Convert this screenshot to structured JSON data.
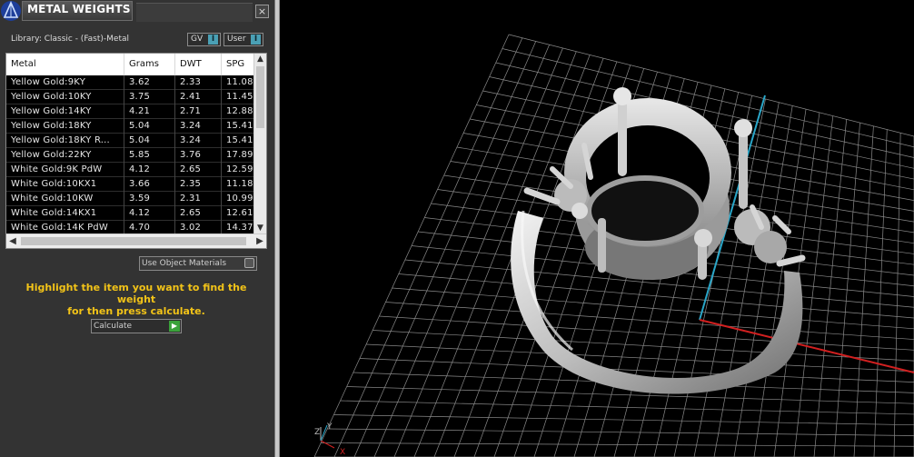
{
  "panel": {
    "title": "METAL WEIGHTS",
    "close_glyph": "×",
    "library_label": "Library: Classic - (Fast)-Metal",
    "toggle_gv": "GV",
    "toggle_user": "User",
    "toggle_glyph": "I",
    "table": {
      "columns": [
        "Metal",
        "Grams",
        "DWT",
        "SPG"
      ],
      "rows": [
        [
          "Yellow Gold:9KY",
          "3.62",
          "2.33",
          "11.08"
        ],
        [
          "Yellow Gold:10KY",
          "3.75",
          "2.41",
          "11.45"
        ],
        [
          "Yellow Gold:14KY",
          "4.21",
          "2.71",
          "12.88"
        ],
        [
          "Yellow Gold:18KY",
          "5.04",
          "3.24",
          "15.41"
        ],
        [
          "Yellow Gold:18KY R...",
          "5.04",
          "3.24",
          "15.41"
        ],
        [
          "Yellow Gold:22KY",
          "5.85",
          "3.76",
          "17.89"
        ],
        [
          "White Gold:9K PdW",
          "4.12",
          "2.65",
          "12.59"
        ],
        [
          "White Gold:10KX1",
          "3.66",
          "2.35",
          "11.18"
        ],
        [
          "White Gold:10KW",
          "3.59",
          "2.31",
          "10.99"
        ],
        [
          "White Gold:14KX1",
          "4.12",
          "2.65",
          "12.61"
        ],
        [
          "White Gold:14K PdW",
          "4.70",
          "3.02",
          "14.37"
        ]
      ]
    },
    "use_object_materials_label": "Use Object Materials",
    "hint_line1": "Highlight the item you want to find the weight",
    "hint_line2": "for then press calculate.",
    "calculate_label": "Calculate"
  },
  "viewport": {
    "axis_x_label": "X",
    "axis_y_label": "Y",
    "axis_z_label": "Z",
    "colors": {
      "grid": "#8a8a8a",
      "x_axis": "#d22020",
      "y_axis": "#2aa6c8",
      "ring_metal": "#cfcfcf"
    }
  }
}
